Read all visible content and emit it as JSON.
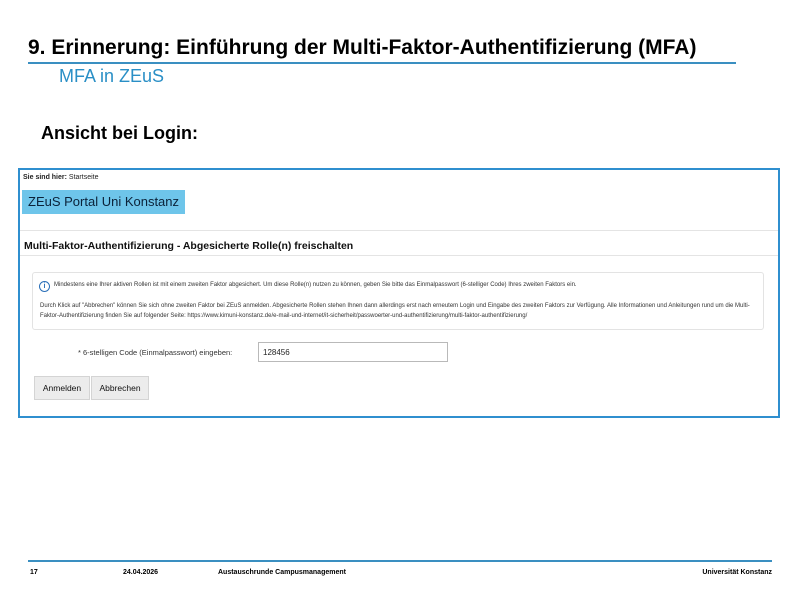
{
  "slide": {
    "title": "9. Erinnerung: Einführung der Multi-Faktor-Authentifizierung (MFA)",
    "subtitle": "MFA in ZEuS",
    "section_heading": "Ansicht bei Login:"
  },
  "screenshot": {
    "breadcrumb_label": "Sie sind hier:",
    "breadcrumb_value": "Startseite",
    "portal_title": "ZEuS Portal Uni Konstanz",
    "panel_title": "Multi-Faktor-Authentifizierung - Abgesicherte Rolle(n) freischalten",
    "info": {
      "icon": "info-icon",
      "line1": "Mindestens eine Ihrer aktiven Rollen ist mit einem zweiten Faktor abgesichert. Um diese Rolle(n) nutzen zu können, geben Sie bitte das Einmalpasswort (6-stelliger Code) Ihres zweiten Faktors ein.",
      "line2": "Durch Klick auf \"Abbrechen\" können Sie sich ohne zweiten Faktor bei ZEuS anmelden. Abgesicherte Rollen stehen Ihnen dann allerdings erst nach erneutem Login und Eingabe des zweiten Faktors zur Verfügung. Alle Informationen und Anleitungen rund um die Multi-Faktor-Authentifizierung finden Sie auf folgender Seite: https://www.kimuni-konstanz.de/e-mail-und-internet/it-sicherheit/passwoerter-und-authentifizierung/multi-faktor-authentifizierung/"
    },
    "field_label": "* 6-stelligen Code (Einmalpasswort) eingeben:",
    "field_value": "128456",
    "login_button": "Anmelden",
    "cancel_button": "Abbrechen"
  },
  "footer": {
    "page_number": "17",
    "date": "24.04.2026",
    "presentation_title": "Austauschrunde Campusmanagement",
    "institution": "Universität Konstanz"
  },
  "colors": {
    "accent": "#3a8fc1",
    "subtitle": "#2a8fc6",
    "portal_banner": "#6ec5ea"
  }
}
